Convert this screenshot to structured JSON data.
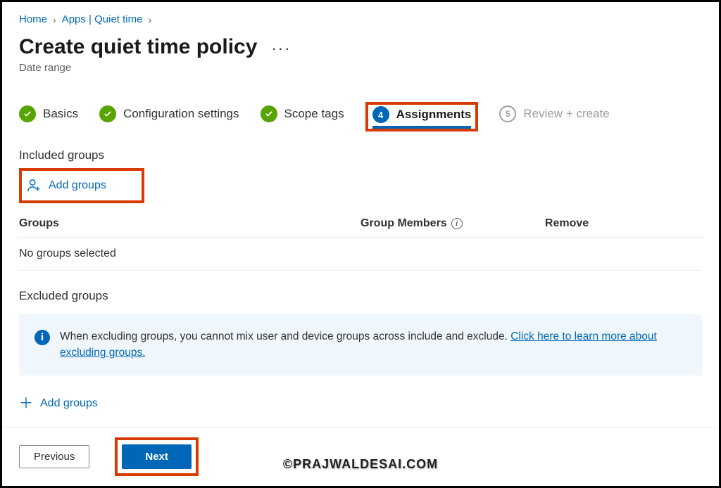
{
  "breadcrumb": {
    "home": "Home",
    "apps": "Apps | Quiet time"
  },
  "page": {
    "title": "Create quiet time policy",
    "subtitle": "Date range"
  },
  "steps": {
    "basics": "Basics",
    "config": "Configuration settings",
    "scope": "Scope tags",
    "assignments": "Assignments",
    "assignments_num": "4",
    "review": "Review + create",
    "review_num": "5"
  },
  "included": {
    "heading": "Included groups",
    "add_button": "Add groups",
    "col_groups": "Groups",
    "col_members": "Group Members",
    "col_remove": "Remove",
    "empty": "No groups selected"
  },
  "excluded": {
    "heading": "Excluded groups",
    "info_text": "When excluding groups, you cannot mix user and device groups across include and exclude. ",
    "info_link": "Click here to learn more about excluding groups.",
    "add_button": "Add groups"
  },
  "footer": {
    "previous": "Previous",
    "next": "Next"
  },
  "watermark": "©PRAJWALDESAI.COM"
}
